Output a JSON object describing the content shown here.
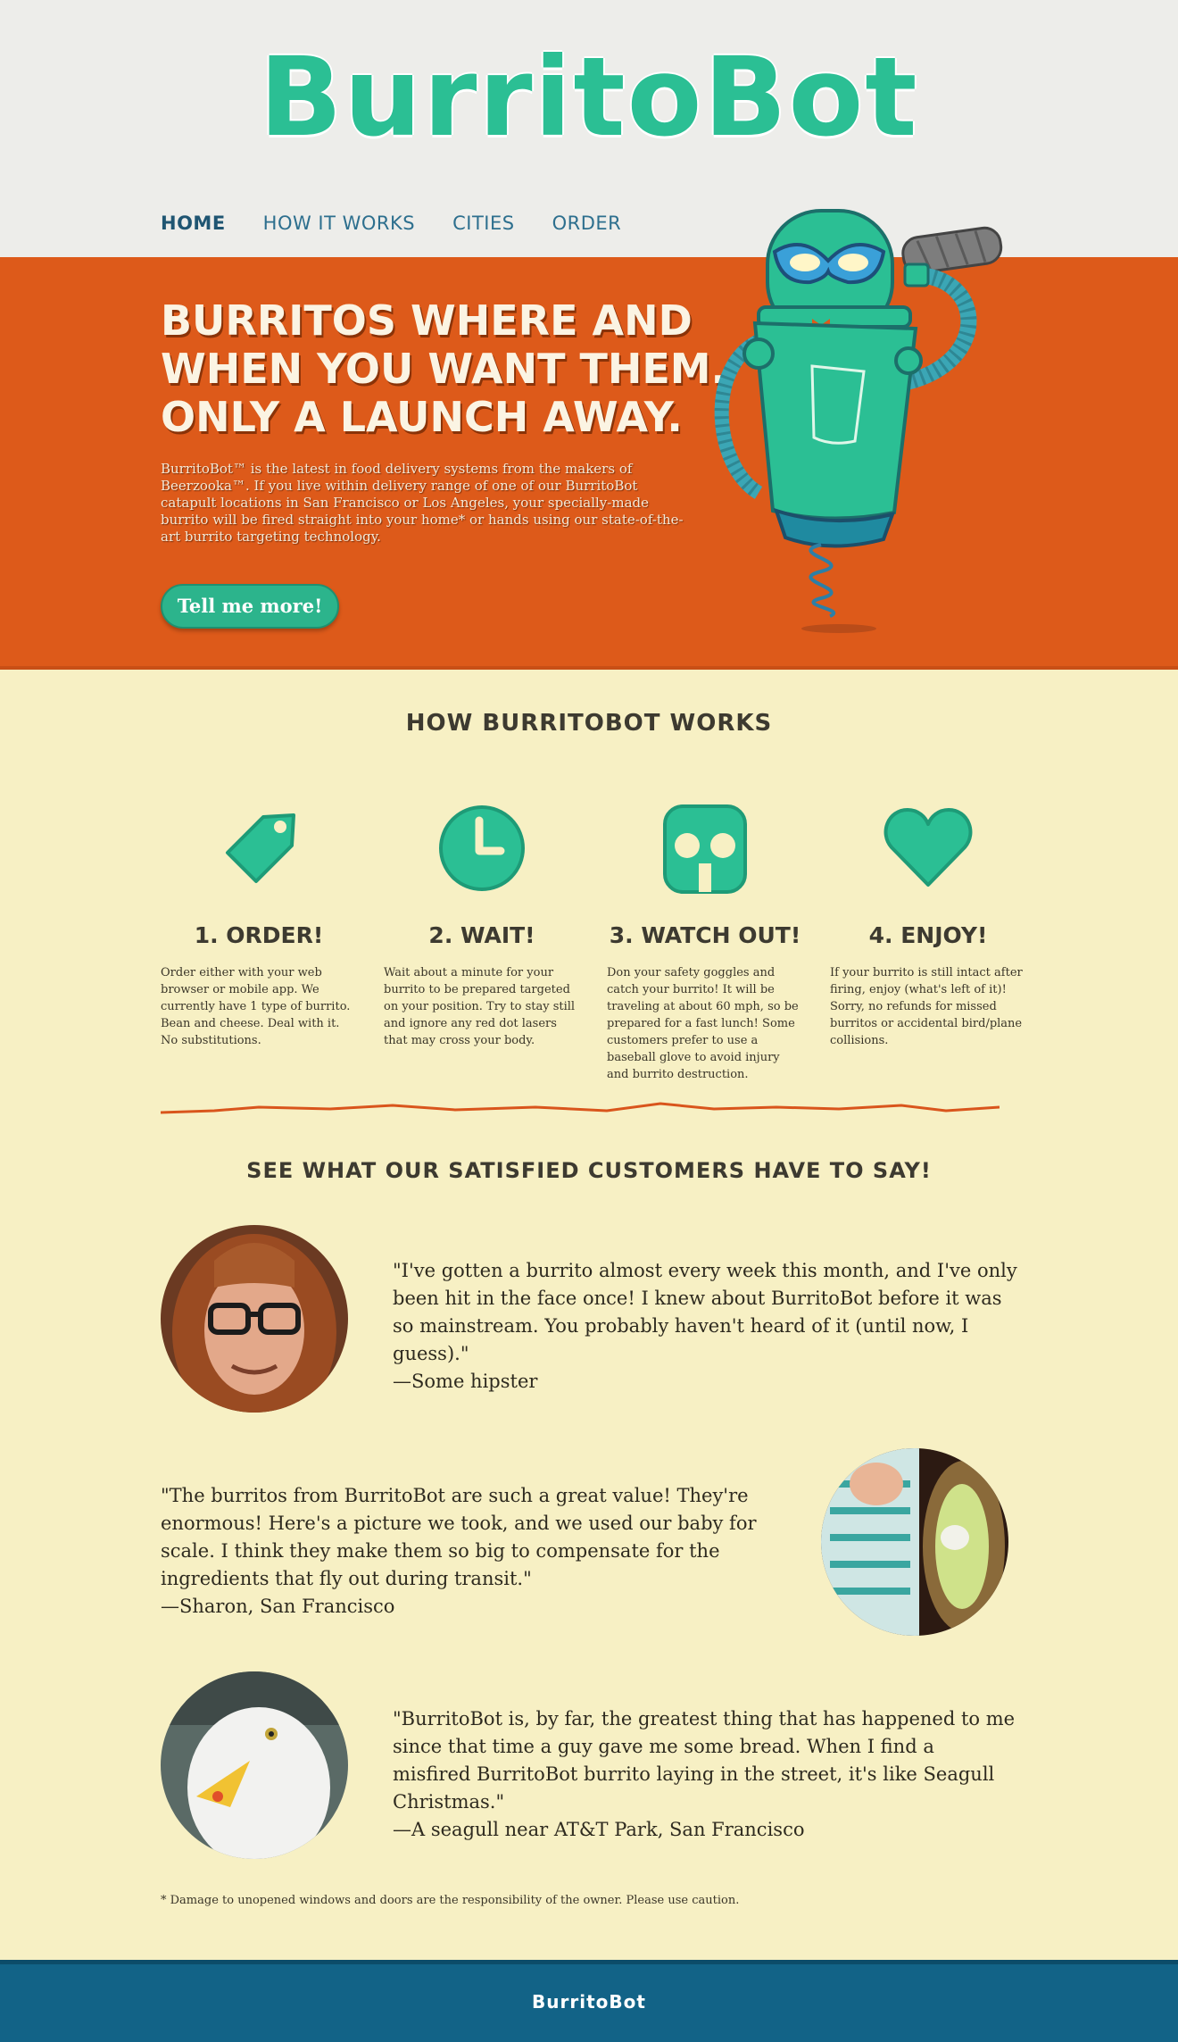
{
  "site": {
    "logo_text": "BurritoBot",
    "nav": [
      {
        "label": "Home",
        "active": true
      },
      {
        "label": "How it works",
        "active": false
      },
      {
        "label": "Cities",
        "active": false
      },
      {
        "label": "Order",
        "active": false
      }
    ]
  },
  "hero": {
    "headline_lines": [
      "Burritos where and",
      "when you want them.",
      "Only a launch away."
    ],
    "body": "BurritoBot™ is the latest in food delivery systems from the makers of Beerzooka™. If you live within delivery range of one of our BurritoBot catapult locations in San Francisco or Los Angeles, your specially-made burrito will be fired straight into your home* or hands using our state-of-the-art burrito targeting technology.",
    "cta_label": "Tell me more!",
    "robot_icon": "robot-with-burrito-icon"
  },
  "how_it_works": {
    "title": "How BurritoBot works",
    "steps": [
      {
        "icon": "tag-icon",
        "title": "1. Order!",
        "text": "Order either with your web browser or mobile app. We currently have 1 type of burrito. Bean and cheese. Deal with it. No substitutions."
      },
      {
        "icon": "clock-icon",
        "title": "2. Wait!",
        "text": "Wait about a minute for your burrito to be prepared targeted on your position. Try to stay still and ignore any red dot lasers that may cross your body."
      },
      {
        "icon": "skull-icon",
        "title": "3. Watch out!",
        "text": "Don your safety goggles and catch your burrito! It will be traveling at about 60 mph, so be prepared for a fast lunch! Some customers prefer to use a baseball glove to avoid injury and burrito destruction."
      },
      {
        "icon": "heart-icon",
        "title": "4. Enjoy!",
        "text": "If your burrito is still intact after firing, enjoy (what's left of it)! Sorry, no refunds for missed burritos or accidental bird/plane collisions."
      }
    ]
  },
  "testimonials": {
    "title": "See what our satisfied customers have to say!",
    "items": [
      {
        "quote": "\"I've gotten a burrito almost every week this month, and I've only been hit in the face once! I knew about BurritoBot before it was so mainstream. You probably haven't heard of it (until now, I guess).\"",
        "author": "—Some hipster",
        "avatar": "hipster-avatar"
      },
      {
        "quote": "\"The burritos from BurritoBot are such a great value! They're enormous! Here's a picture we took, and we used our baby for scale. I think they make them so big to compensate for the ingredients that fly out during transit.\"",
        "author": "—Sharon, San Francisco",
        "avatar": "baby-burrito-photo"
      },
      {
        "quote": "\"BurritoBot is, by far, the greatest thing that has happened to me since that time a guy gave me some bread. When I find a misfired BurritoBot burrito laying in the street, it's like Seagull Christmas.\"",
        "author": "—A seagull near AT&T Park, San Francisco",
        "avatar": "seagull-avatar"
      }
    ]
  },
  "footnote": "* Damage to unopened windows and doors are the responsibility of the owner. Please use caution.",
  "footer": {
    "logo_text": "BurritoBot"
  },
  "colors": {
    "teal": "#2bbf94",
    "orange": "#dd5a1a",
    "cream": "#f7f0c4",
    "navy": "#126387"
  }
}
